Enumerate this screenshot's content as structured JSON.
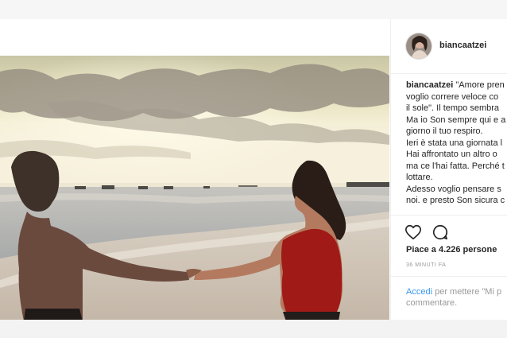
{
  "post": {
    "username": "biancaatzei",
    "caption_lines": [
      "\"Amore pren",
      "voglio correre veloce co",
      "il sole\". Il tempo sembra",
      "Ma io Son sempre qui e a",
      "giorno il tuo respiro.",
      "Ieri è stata una giornata l",
      "Hai affrontato un altro o",
      "ma ce l'hai fatta. Perché t",
      "lottare.",
      "Adesso voglio pensare s",
      "noi. e presto Son sicura c"
    ],
    "likes": "Piace a 4.226 persone",
    "time": "36 MINUTI FA",
    "login_link": "Accedi",
    "login_text_1": " per mettere \"Mi p",
    "login_text_2": "commentare.",
    "icons": {
      "like": "heart-icon",
      "comment": "comment-icon"
    },
    "colors": {
      "link": "#3897f0",
      "text": "#262626",
      "muted": "#999999"
    }
  }
}
